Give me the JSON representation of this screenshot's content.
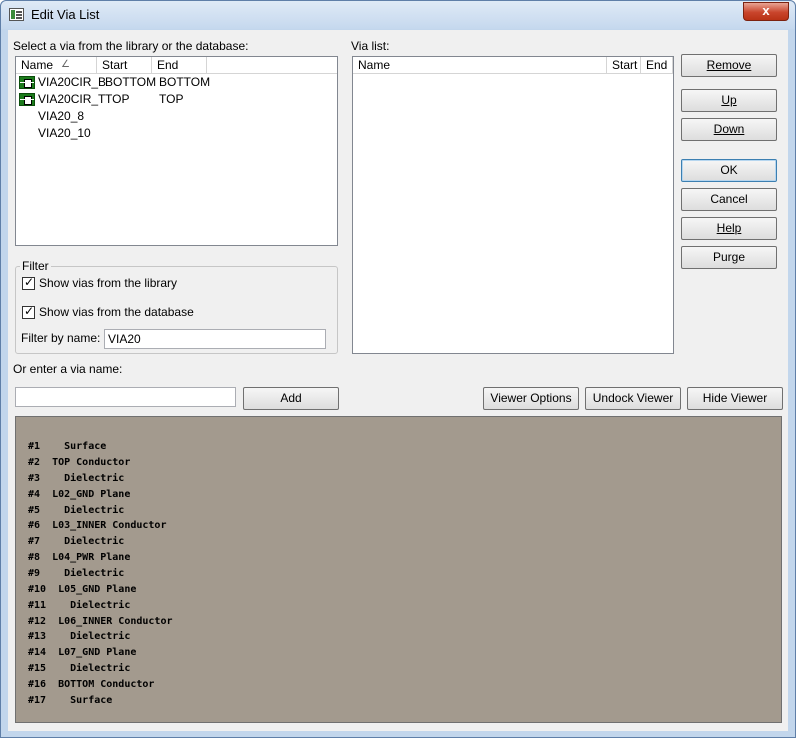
{
  "window": {
    "title": "Edit Via List",
    "close_label": "x"
  },
  "library": {
    "label": "Select a via from the library or the database:",
    "columns": [
      "Name",
      "Start",
      "End"
    ],
    "sort_indicator": "∠",
    "rows": [
      {
        "name": "VIA20CIR_B",
        "start": "BOTTOM",
        "end": "BOTTOM",
        "icon": "via-icon"
      },
      {
        "name": "VIA20CIR_T",
        "start": "TOP",
        "end": "TOP",
        "icon": "via-icon"
      },
      {
        "name": "VIA20_8",
        "start": "",
        "end": ""
      },
      {
        "name": "VIA20_10",
        "start": "",
        "end": ""
      }
    ]
  },
  "via_list": {
    "label": "Via list:",
    "columns": [
      "Name",
      "Start",
      "End"
    ]
  },
  "filter": {
    "title": "Filter",
    "show_library": {
      "label": "Show vias from the library",
      "checked": true
    },
    "show_database": {
      "label": "Show vias from the database",
      "checked": true
    },
    "filter_by_name_label": "Filter by name:",
    "filter_value": "VIA20"
  },
  "enter_via": {
    "label": "Or enter a via name:",
    "value": "",
    "add_label": "Add"
  },
  "buttons": {
    "remove": "Remove",
    "up": "Up",
    "down": "Down",
    "ok": "OK",
    "cancel": "Cancel",
    "help": "Help",
    "purge": "Purge",
    "viewer_options": "Viewer Options",
    "undock_viewer": "Undock Viewer",
    "hide_viewer": "Hide Viewer"
  },
  "stackup": [
    "#1    Surface",
    "#2  TOP Conductor",
    "#3    Dielectric",
    "#4  L02_GND Plane",
    "#5    Dielectric",
    "#6  L03_INNER Conductor",
    "#7    Dielectric",
    "#8  L04_PWR Plane",
    "#9    Dielectric",
    "#10  L05_GND Plane",
    "#11    Dielectric",
    "#12  L06_INNER Conductor",
    "#13    Dielectric",
    "#14  L07_GND Plane",
    "#15    Dielectric",
    "#16  BOTTOM Conductor",
    "#17    Surface"
  ],
  "colors": {
    "viewer_bg": "#a39a8e",
    "via_icon": "#1c7b1c",
    "close_button": "#c9452c"
  }
}
